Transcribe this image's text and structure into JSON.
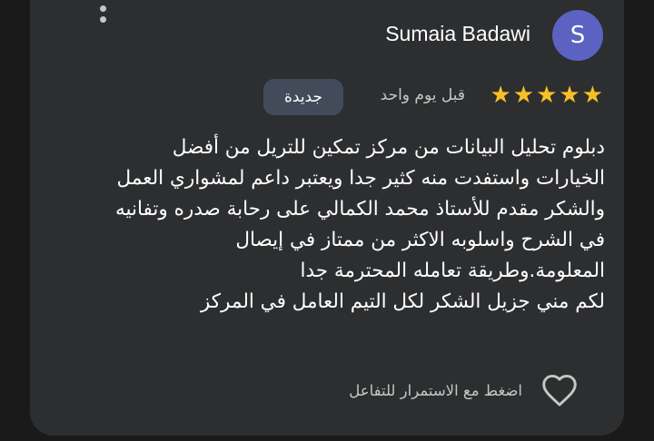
{
  "review": {
    "user": {
      "avatar_letter": "S",
      "avatar_color": "#5b62c2",
      "name": "Sumaia Badawi"
    },
    "rating": 5,
    "stars": [
      "★",
      "★",
      "★",
      "★",
      "★"
    ],
    "time_ago": "قبل يوم واحد",
    "badge": "جديدة",
    "text_lines": [
      "دبلوم تحليل البيانات من مركز تمكين للتريل من أفضل",
      "الخيارات واستفدت منه كثير جدا ويعتبر داعم لمشواري العمل",
      "والشكر مقدم للأستاذ محمد الكمالي على رحابة صدره وتفانيه",
      "في الشرح واسلوبه الاكثر من ممتاز في إيصال",
      "المعلومة.وطريقة تعامله المحترمة جدا",
      "لكم مني جزيل الشكر لكل التيم العامل في المركز"
    ],
    "react_hint": "اضغط مع الاستمرار للتفاعل"
  },
  "icons": {
    "menu": "more-vertical-icon",
    "heart": "heart-outline-icon",
    "star": "star-icon"
  },
  "colors": {
    "card_bg": "#2d2e30",
    "star": "#f6c026",
    "badge_bg": "#434b5a"
  }
}
